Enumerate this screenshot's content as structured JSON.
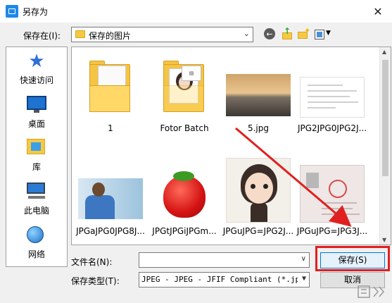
{
  "window": {
    "title": "另存为",
    "close_glyph": "✕"
  },
  "toolbar": {
    "save_in_label": "保存在(I):",
    "current_folder": "保存的图片",
    "back_icon": "back-arrow-icon",
    "up_icon": "up-folder-icon",
    "new_folder_icon": "new-folder-icon",
    "view_icon": "view-menu-icon"
  },
  "places": [
    {
      "label": "快速访问",
      "icon": "star-icon"
    },
    {
      "label": "桌面",
      "icon": "desktop-icon"
    },
    {
      "label": "库",
      "icon": "library-icon"
    },
    {
      "label": "此电脑",
      "icon": "computer-icon"
    },
    {
      "label": "网络",
      "icon": "network-icon"
    }
  ],
  "files": [
    {
      "name": "1",
      "kind": "folder"
    },
    {
      "name": "Fotor Batch",
      "kind": "folder"
    },
    {
      "name": "5.jpg",
      "kind": "image"
    },
    {
      "name": "JPG2JPG0JPG2J...",
      "kind": "image"
    },
    {
      "name": "JPGaJPG0JPG8J...",
      "kind": "image"
    },
    {
      "name": "JPGtJPGiJPGm...",
      "kind": "image"
    },
    {
      "name": "JPGuJPG=JPG2J...",
      "kind": "image"
    },
    {
      "name": "JPGuJPG=JPG3J...",
      "kind": "image"
    }
  ],
  "form": {
    "filename_label": "文件名(N):",
    "filename_value": "",
    "filetype_label": "保存类型(T):",
    "filetype_value": "JPEG - JPEG - JFIF Compliant (*.jpg;*",
    "save_button": "保存(S)",
    "cancel_button": "取消"
  },
  "colors": {
    "accent": "#0078d7",
    "annotation": "#e02020"
  }
}
